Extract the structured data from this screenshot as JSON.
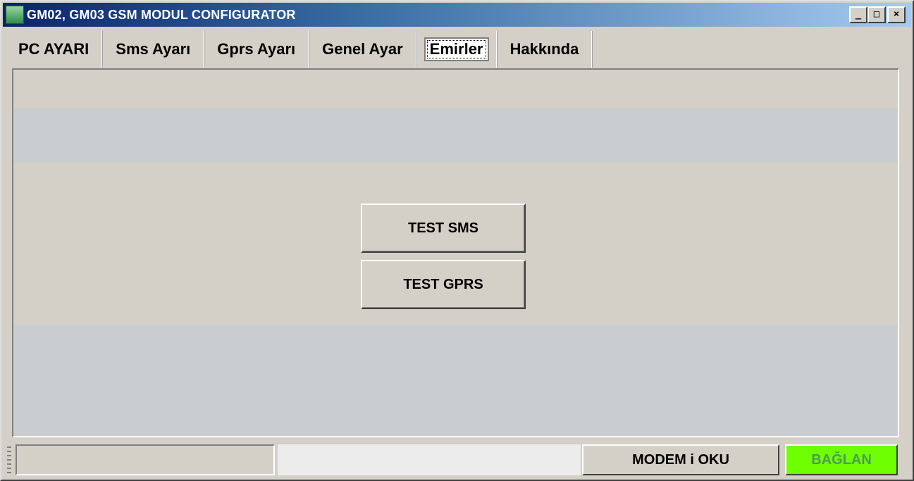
{
  "window": {
    "title": "GM02, GM03 GSM MODUL CONFIGURATOR",
    "controls": {
      "minimize": "_",
      "maximize": "□",
      "close": "×"
    }
  },
  "tabs": [
    {
      "label": "PC AYARI",
      "selected": false
    },
    {
      "label": "Sms Ayarı",
      "selected": false
    },
    {
      "label": "Gprs Ayarı",
      "selected": false
    },
    {
      "label": "Genel Ayar",
      "selected": false
    },
    {
      "label": "Emirler",
      "selected": true
    },
    {
      "label": "Hakkında",
      "selected": false
    }
  ],
  "panel": {
    "test_sms_label": "TEST SMS",
    "test_gprs_label": "TEST GPRS"
  },
  "statusbar": {
    "status_text": "",
    "modem_button": "MODEM i OKU",
    "connect_button": "BAĞLAN"
  },
  "colors": {
    "connect_button_bg": "#6eff00",
    "connect_button_text": "#4c9a60",
    "titlebar_start": "#0a246a"
  }
}
